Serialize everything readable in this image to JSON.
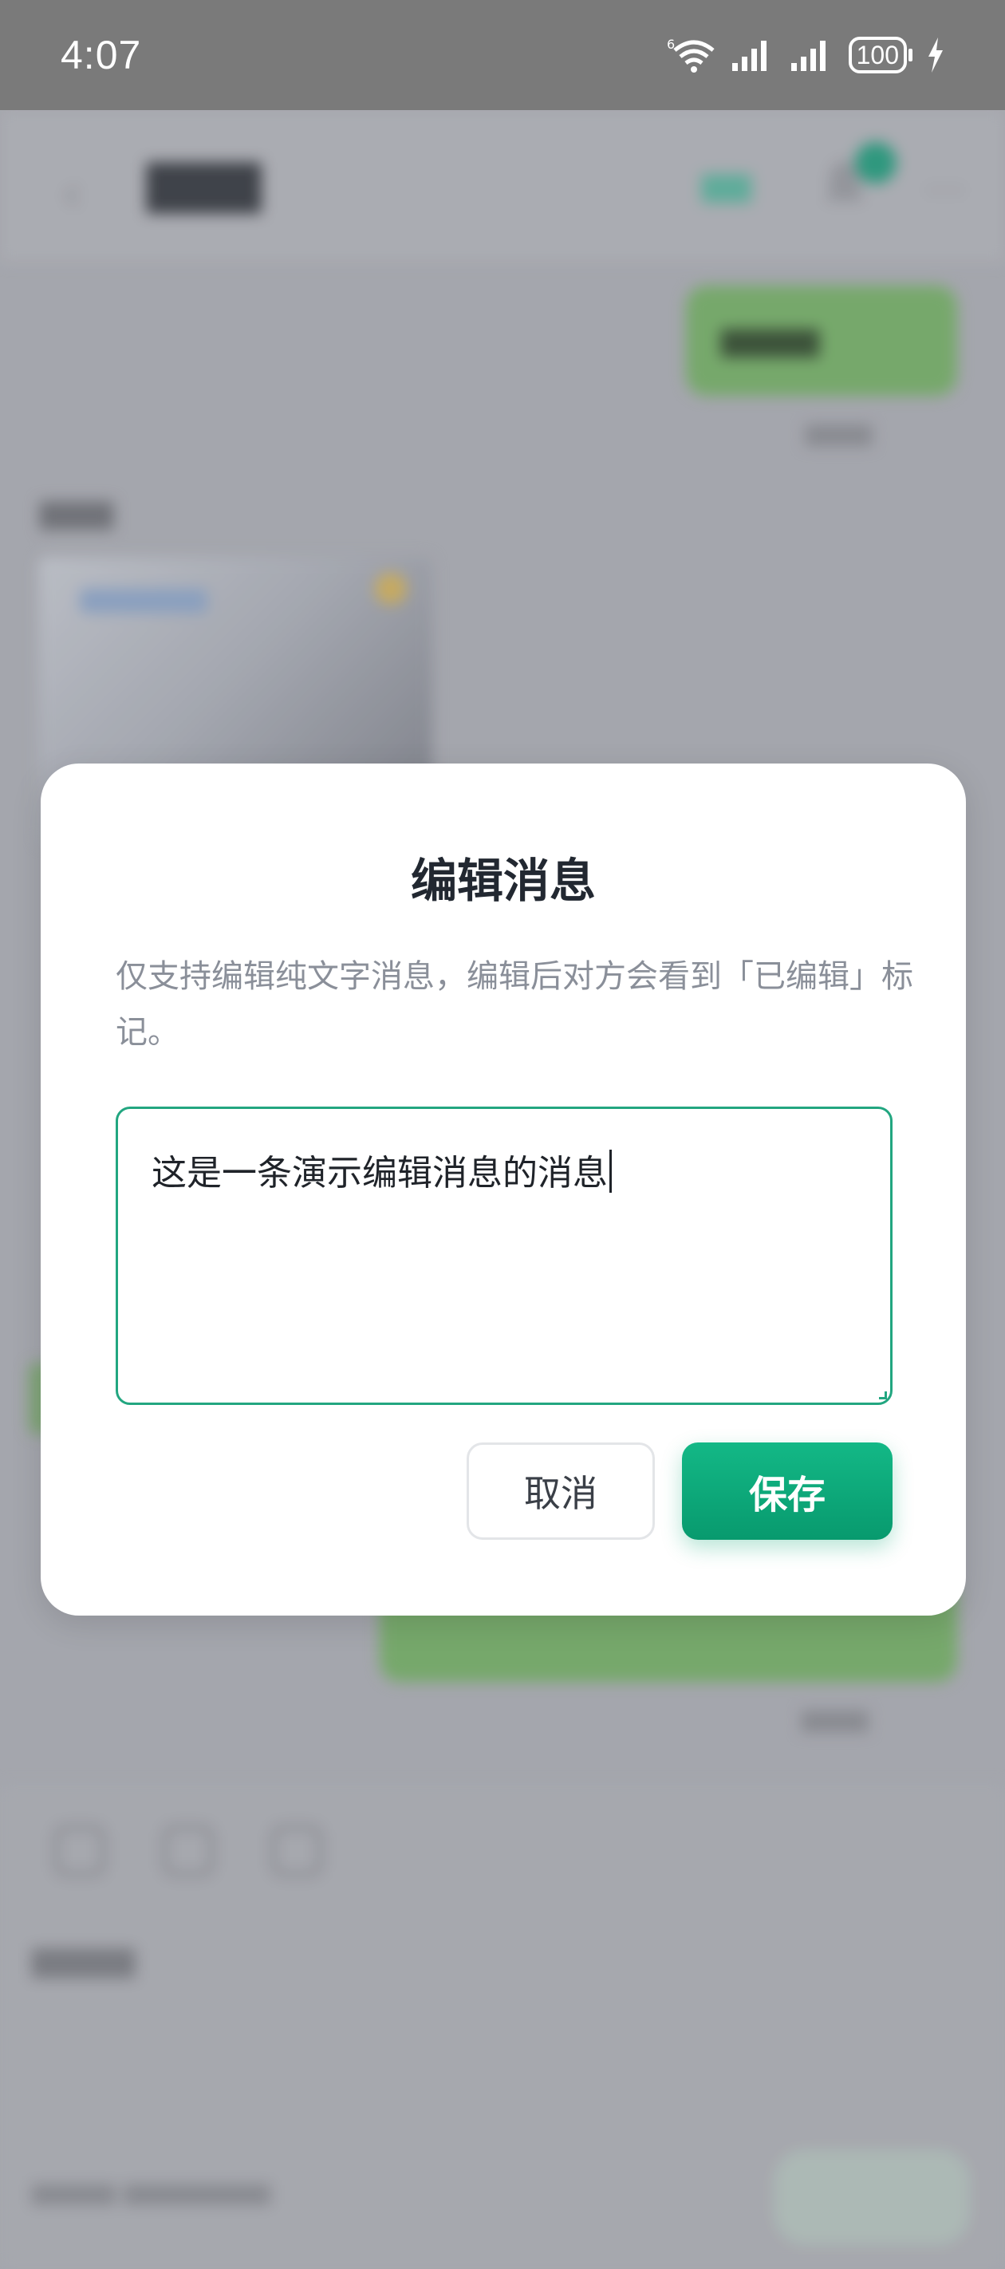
{
  "status_bar": {
    "time": "4:07",
    "battery": "100",
    "icons": [
      "wifi-icon",
      "signal-icon",
      "signal-icon",
      "battery-icon",
      "charging-icon"
    ]
  },
  "modal": {
    "title": "编辑消息",
    "description": "仅支持编辑纯文字消息，编辑后对方会看到「已编辑」标记。",
    "textarea_value": "这是一条演示编辑消息的消息",
    "cancel_label": "取消",
    "save_label": "保存"
  },
  "colors": {
    "accent": "#11a67a",
    "focus_border": "#22a680"
  }
}
